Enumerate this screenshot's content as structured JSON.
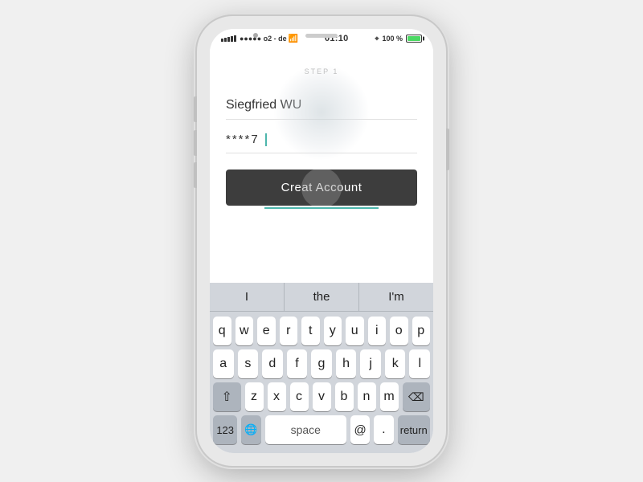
{
  "phone": {
    "status_bar": {
      "carrier": "●●●●● o2 - de",
      "wifi": "▾",
      "time": "01:10",
      "location_arrow": "⊙",
      "battery_text": "100 %"
    },
    "form": {
      "step_label": "STEP 1",
      "name_value": "Siegfried WU",
      "password_value": "****7",
      "create_button_label": "Creat Account"
    },
    "keyboard": {
      "autocorrect": [
        "I",
        "the",
        "I'm"
      ],
      "row1": [
        "q",
        "w",
        "e",
        "r",
        "t",
        "y",
        "u",
        "i",
        "o",
        "p"
      ],
      "row2": [
        "a",
        "s",
        "d",
        "f",
        "g",
        "h",
        "j",
        "k",
        "l"
      ],
      "row3": [
        "z",
        "x",
        "c",
        "v",
        "b",
        "n",
        "m"
      ],
      "special_shift": "⇧",
      "special_delete": "⌫",
      "special_num": "123",
      "special_globe": "🌐",
      "special_space": "space",
      "special_at": "@",
      "special_period": ".",
      "special_return": "return"
    }
  }
}
